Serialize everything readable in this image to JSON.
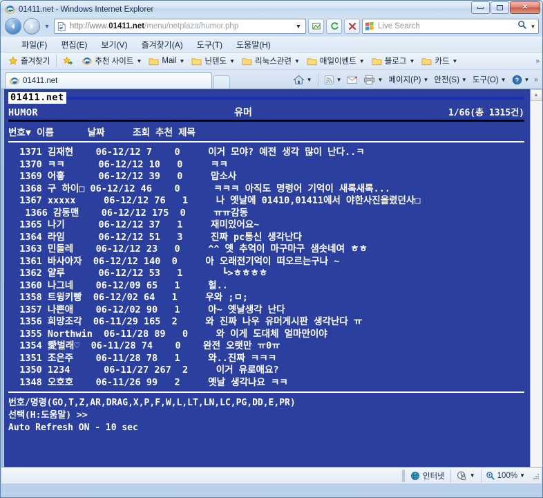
{
  "window": {
    "title": "01411.net - Windows Internet Explorer",
    "minimize_label": "최소화",
    "maximize_label": "최대화",
    "close_label": "닫기"
  },
  "navigation": {
    "back_label": "뒤로",
    "forward_label": "앞으로",
    "recent_pages_label": "최근 페이지",
    "address": {
      "scheme_host_pre": "http://www.",
      "host_bold": "01411.net",
      "path": "/menu/netplaza/humor.php",
      "full_url": "http://www.01411.net/menu/netplaza/humor.php",
      "dropdown_label": "주소 목록"
    },
    "compat_view_label": "호환성 보기",
    "refresh_label": "새로 고침",
    "stop_label": "중지",
    "search": {
      "placeholder": "Live Search",
      "go_label": "검색",
      "dropdown_label": "검색 공급자"
    }
  },
  "menubar": {
    "items": [
      {
        "label": "파일(F)",
        "text": "파일",
        "accel": "F"
      },
      {
        "label": "편집(E)",
        "text": "편집",
        "accel": "E"
      },
      {
        "label": "보기(V)",
        "text": "보기",
        "accel": "V"
      },
      {
        "label": "즐겨찾기(A)",
        "text": "즐겨찾기",
        "accel": "A"
      },
      {
        "label": "도구(T)",
        "text": "도구",
        "accel": "T"
      },
      {
        "label": "도움말(H)",
        "text": "도움말",
        "accel": "H"
      }
    ]
  },
  "favorites_bar": {
    "favorites_button": "즐겨찾기",
    "add_to_favorites_label": "즐겨찾기에 추가",
    "items": [
      {
        "label": "추천 사이트",
        "icon": "ie-icon",
        "has_caret": true
      },
      {
        "label": "Mail",
        "icon": "folder-icon",
        "has_caret": true
      },
      {
        "label": "닌텐도",
        "icon": "folder-icon",
        "has_caret": true
      },
      {
        "label": "리눅스관련",
        "icon": "folder-icon",
        "has_caret": true
      },
      {
        "label": "매일이벤트",
        "icon": "folder-icon",
        "has_caret": true
      },
      {
        "label": "블로그",
        "icon": "folder-icon",
        "has_caret": true
      },
      {
        "label": "카드",
        "icon": "folder-icon",
        "has_caret": true
      }
    ],
    "overflow": "»"
  },
  "tabs": {
    "items": [
      {
        "title": "01411.net",
        "active": true
      }
    ],
    "new_tab_label": "새 탭"
  },
  "command_bar": {
    "home_label": "홈",
    "feeds_label": "피드",
    "mail_label": "읽기 메일",
    "print_label": "인쇄",
    "items": [
      {
        "label": "페이지(P)",
        "caret": true
      },
      {
        "label": "안전(S)",
        "caret": true
      },
      {
        "label": "도구(O)",
        "caret": true
      },
      {
        "label": "도움말",
        "caret": true,
        "icon": "help-icon"
      }
    ],
    "overflow": "»"
  },
  "bbs": {
    "site_logo": "01411.net",
    "board_code": "HUMOR",
    "board_title": "유머",
    "page_info": "1/66(총  1315건)",
    "column_header": "번호▼ 이름      날짜     조회 추천 제목",
    "columns": [
      "번호▼",
      "이름",
      "날짜",
      "조회",
      "추천",
      "제목"
    ],
    "rows": [
      {
        "no": "1371",
        "name": "김재현",
        "date": "06-12/12",
        "hits": "7",
        "rec": "0",
        "title": "이거 모야? 예전 생각 많이 난다..ㅋ",
        "green": false,
        "line": "  1371 김재현    06-12/12 7    0     이거 모야? 예전 생각 많이 난다..ㅋ"
      },
      {
        "no": "1370",
        "name": "ㅋㅋ",
        "date": "06-12/12",
        "hits": "10",
        "rec": "0",
        "title": "ㅋㅋ",
        "green": false,
        "line": "  1370 ㅋㅋ      06-12/12 10   0     ㅋㅋ"
      },
      {
        "no": "1369",
        "name": "어흫",
        "date": "06-12/12",
        "hits": "39",
        "rec": "0",
        "title": "맙소사",
        "green": false,
        "line": "  1369 어흫      06-12/12 39   0     맙소사"
      },
      {
        "no": "1368",
        "name": "구 하이□",
        "date": "06-12/12",
        "hits": "46",
        "rec": "0",
        "title": "ㅋㅋㅋ 아직도 명령어 기억이 새록새록...",
        "green": false,
        "line": "  1368 구 하이□ 06-12/12 46    0      ㅋㅋㅋ 아직도 명령어 기억이 새록새록..."
      },
      {
        "no": "1367",
        "name": "xxxxx",
        "date": "06-12/12",
        "hits": "76",
        "rec": "1",
        "title": "나 옛날에 01410,01411에서 야한사진올렸던사□",
        "green": false,
        "line": "  1367 xxxxx     06-12/12 76   1     나 옛날에 01410,01411에서 야한사진올렸던사□"
      },
      {
        "no": "1366",
        "name": "감동맨",
        "date": "06-12/12",
        "hits": "175",
        "rec": "0",
        "title": "ㅠㅠ감동",
        "green": true,
        "line": "   1366 감동맨    06-12/12 175  0     ㅠㅠ감동"
      },
      {
        "no": "1365",
        "name": "나기",
        "date": "06-12/12",
        "hits": "37",
        "rec": "1",
        "title": "재미있어요~",
        "green": false,
        "line": "  1365 나기      06-12/12 37   1     재미있어요~"
      },
      {
        "no": "1364",
        "name": "라임",
        "date": "06-12/12",
        "hits": "51",
        "rec": "3",
        "title": "진짜 pc통신 생각난다",
        "green": false,
        "line": "  1364 라임      06-12/12 51   3     진짜 pc통신 생각난다"
      },
      {
        "no": "1363",
        "name": "민들레",
        "date": "06-12/12",
        "hits": "23",
        "rec": "0",
        "title": "^^ 옛 추억이 마구마구 샘솟네여 ㅎㅎ",
        "green": false,
        "line": "  1363 민들레    06-12/12 23   0     ^^ 옛 추억이 마구마구 샘솟네여 ㅎㅎ"
      },
      {
        "no": "1361",
        "name": "바사아자",
        "date": "06-12/12",
        "hits": "140",
        "rec": "0",
        "title": "아 오래전기억이 떠오르는구나 ~",
        "green": true,
        "line": "  1361 바사아자  06-12/12 140  0     아 오래전기억이 떠오르는구나 ~"
      },
      {
        "no": "1362",
        "name": "얄루",
        "date": "06-12/12",
        "hits": "53",
        "rec": "1",
        "title": "┗>ㅎㅎㅎㅎ",
        "green": false,
        "line": "  1362 얄루      06-12/12 53   1       ┗>ㅎㅎㅎㅎ"
      },
      {
        "no": "1360",
        "name": "나그네",
        "date": "06-12/09",
        "hits": "65",
        "rec": "1",
        "title": "헐..",
        "green": false,
        "line": "  1360 나그네    06-12/09 65   1     헐.."
      },
      {
        "no": "1358",
        "name": "트윙키빵",
        "date": "06-12/02",
        "hits": "64",
        "rec": "1",
        "title": "우와 ;ㅁ;",
        "green": false,
        "line": "  1358 트윙키빵  06-12/02 64   1     우와 ;ㅁ;"
      },
      {
        "no": "1357",
        "name": "나쁜애",
        "date": "06-12/02",
        "hits": "90",
        "rec": "1",
        "title": "아~ 옛날생각 난다",
        "green": false,
        "line": "  1357 나쁜애    06-12/02 90   1     아~ 옛날생각 난다"
      },
      {
        "no": "1356",
        "name": "희망조각",
        "date": "06-11/29",
        "hits": "165",
        "rec": "2",
        "title": "와 진짜 나우 유머게시판 생각난다 ㅠ",
        "green": true,
        "line": "  1356 희망조각  06-11/29 165  2     와 진짜 나우 유머게시판 생각난다 ㅠ"
      },
      {
        "no": "1355",
        "name": "Northwin",
        "date": "06-11/28",
        "hits": "89",
        "rec": "0",
        "title": "와 이게 도대체 얼마만이야",
        "green": false,
        "line": "  1355 Northwin  06-11/28 89   0     와 이게 도대체 얼마만이야"
      },
      {
        "no": "1354",
        "name": "愛벌래♡",
        "date": "06-11/28",
        "hits": "74",
        "rec": "0",
        "title": "완전 오랫만 ㅠ0ㅠ",
        "green": false,
        "line": "  1354 愛벌래♡  06-11/28 74    0    완전 오랫만 ㅠ0ㅠ"
      },
      {
        "no": "1351",
        "name": "조은주",
        "date": "06-11/28",
        "hits": "78",
        "rec": "1",
        "title": "와..진짜 ㅋㅋㅋ",
        "green": false,
        "line": "  1351 조은주    06-11/28 78   1     와..진짜 ㅋㅋㅋ"
      },
      {
        "no": "1350",
        "name": "1234",
        "date": "06-11/27",
        "hits": "267",
        "rec": "2",
        "title": "이거 유로애요?",
        "green": true,
        "line": "  1350 1234      06-11/27 267  2     이거 유로애요?"
      },
      {
        "no": "1348",
        "name": "오호호",
        "date": "06-11/26",
        "hits": "99",
        "rec": "2",
        "title": "옛날 생각나요 ㅋㅋ",
        "green": false,
        "line": "  1348 오호호    06-11/26 99   2     옛날 생각나요 ㅋㅋ"
      }
    ],
    "prompt_command": "번호/명령(GO,T,Z,AR,DRAG,X,P,F,W,L,LT,LN,LC,PG,DD,E,PR)",
    "prompt_select": "선택(H:도움말) >>",
    "auto_refresh": "Auto Refresh ON - 10 sec"
  },
  "statusbar": {
    "zone": "인터넷",
    "zoom": "100%",
    "protected_mode_label": "보호 모드"
  },
  "colors": {
    "bbs_background": "#2b3f9e",
    "bbs_text": "#ffffff",
    "bbs_green": "#24d14a",
    "logo_background": "#ffffff",
    "logo_text": "#000000",
    "rule_blue": "#1b2fb0",
    "rule_black": "#000000",
    "titlebar_text": "#0d2a52"
  }
}
